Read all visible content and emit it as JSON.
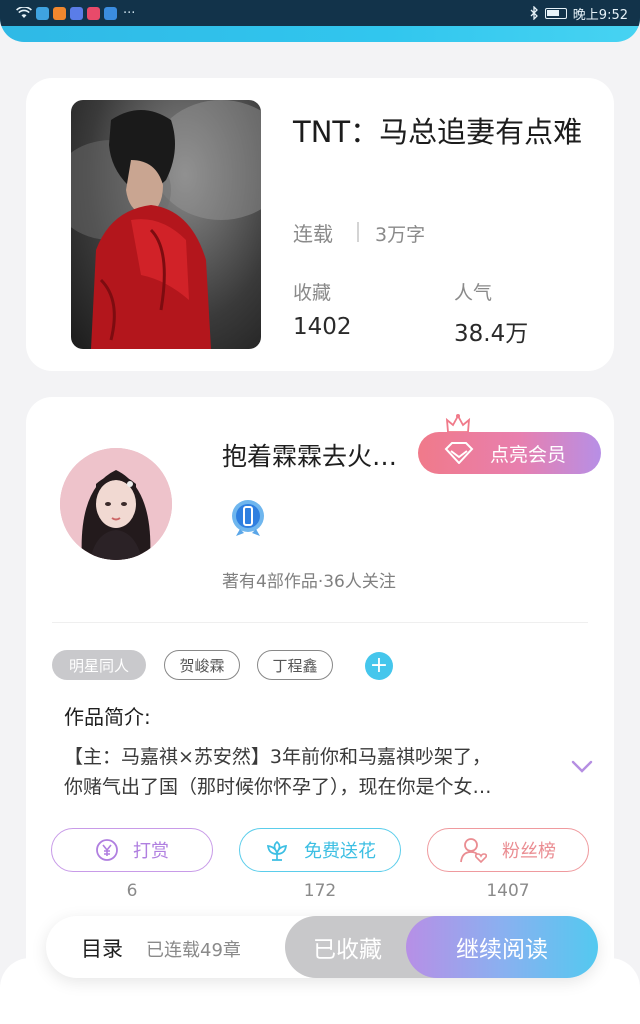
{
  "status_bar": {
    "time": "晚上9:52",
    "overflow_indicator": "···",
    "icons": [
      "wifi-icon",
      "app-icon",
      "app-icon",
      "app-icon",
      "app-icon",
      "app-icon",
      "bluetooth-icon",
      "battery-icon"
    ]
  },
  "book": {
    "title": "TNT：马总追妻有点难",
    "status": "连载",
    "word_count": "3万字",
    "favorites_label": "收藏",
    "favorites_value": "1402",
    "popularity_label": "人气",
    "popularity_value": "38.4万"
  },
  "author": {
    "name": "抱着霖霖去火…",
    "vip_label": "点亮会员",
    "meta": "著有4部作品·36人关注"
  },
  "tags": [
    "明星同人",
    "贺峻霖",
    "丁程鑫"
  ],
  "intro": {
    "title": "作品简介:",
    "line1": "【主：马嘉祺×苏安然】3年前你和马嘉祺吵架了，",
    "line2": "你赌气出了国（那时候你怀孕了），现在你是个女…"
  },
  "actions": {
    "reward_label": "打赏",
    "reward_count": "6",
    "flower_label": "免费送花",
    "flower_count": "172",
    "fans_label": "粉丝榜",
    "fans_count": "1407"
  },
  "bottom_bar": {
    "toc_label": "目录",
    "chapters": "已连载49章",
    "collected_label": "已收藏",
    "read_label": "继续阅读"
  },
  "colors": {
    "accent_cyan": "#45c6ec",
    "vip_gradient_start": "#f07a8a",
    "vip_gradient_end": "#b78fe6",
    "reward_purple": "#b07fe0",
    "flower_cyan": "#3dbfe3",
    "fans_pink": "#ea8d92"
  }
}
